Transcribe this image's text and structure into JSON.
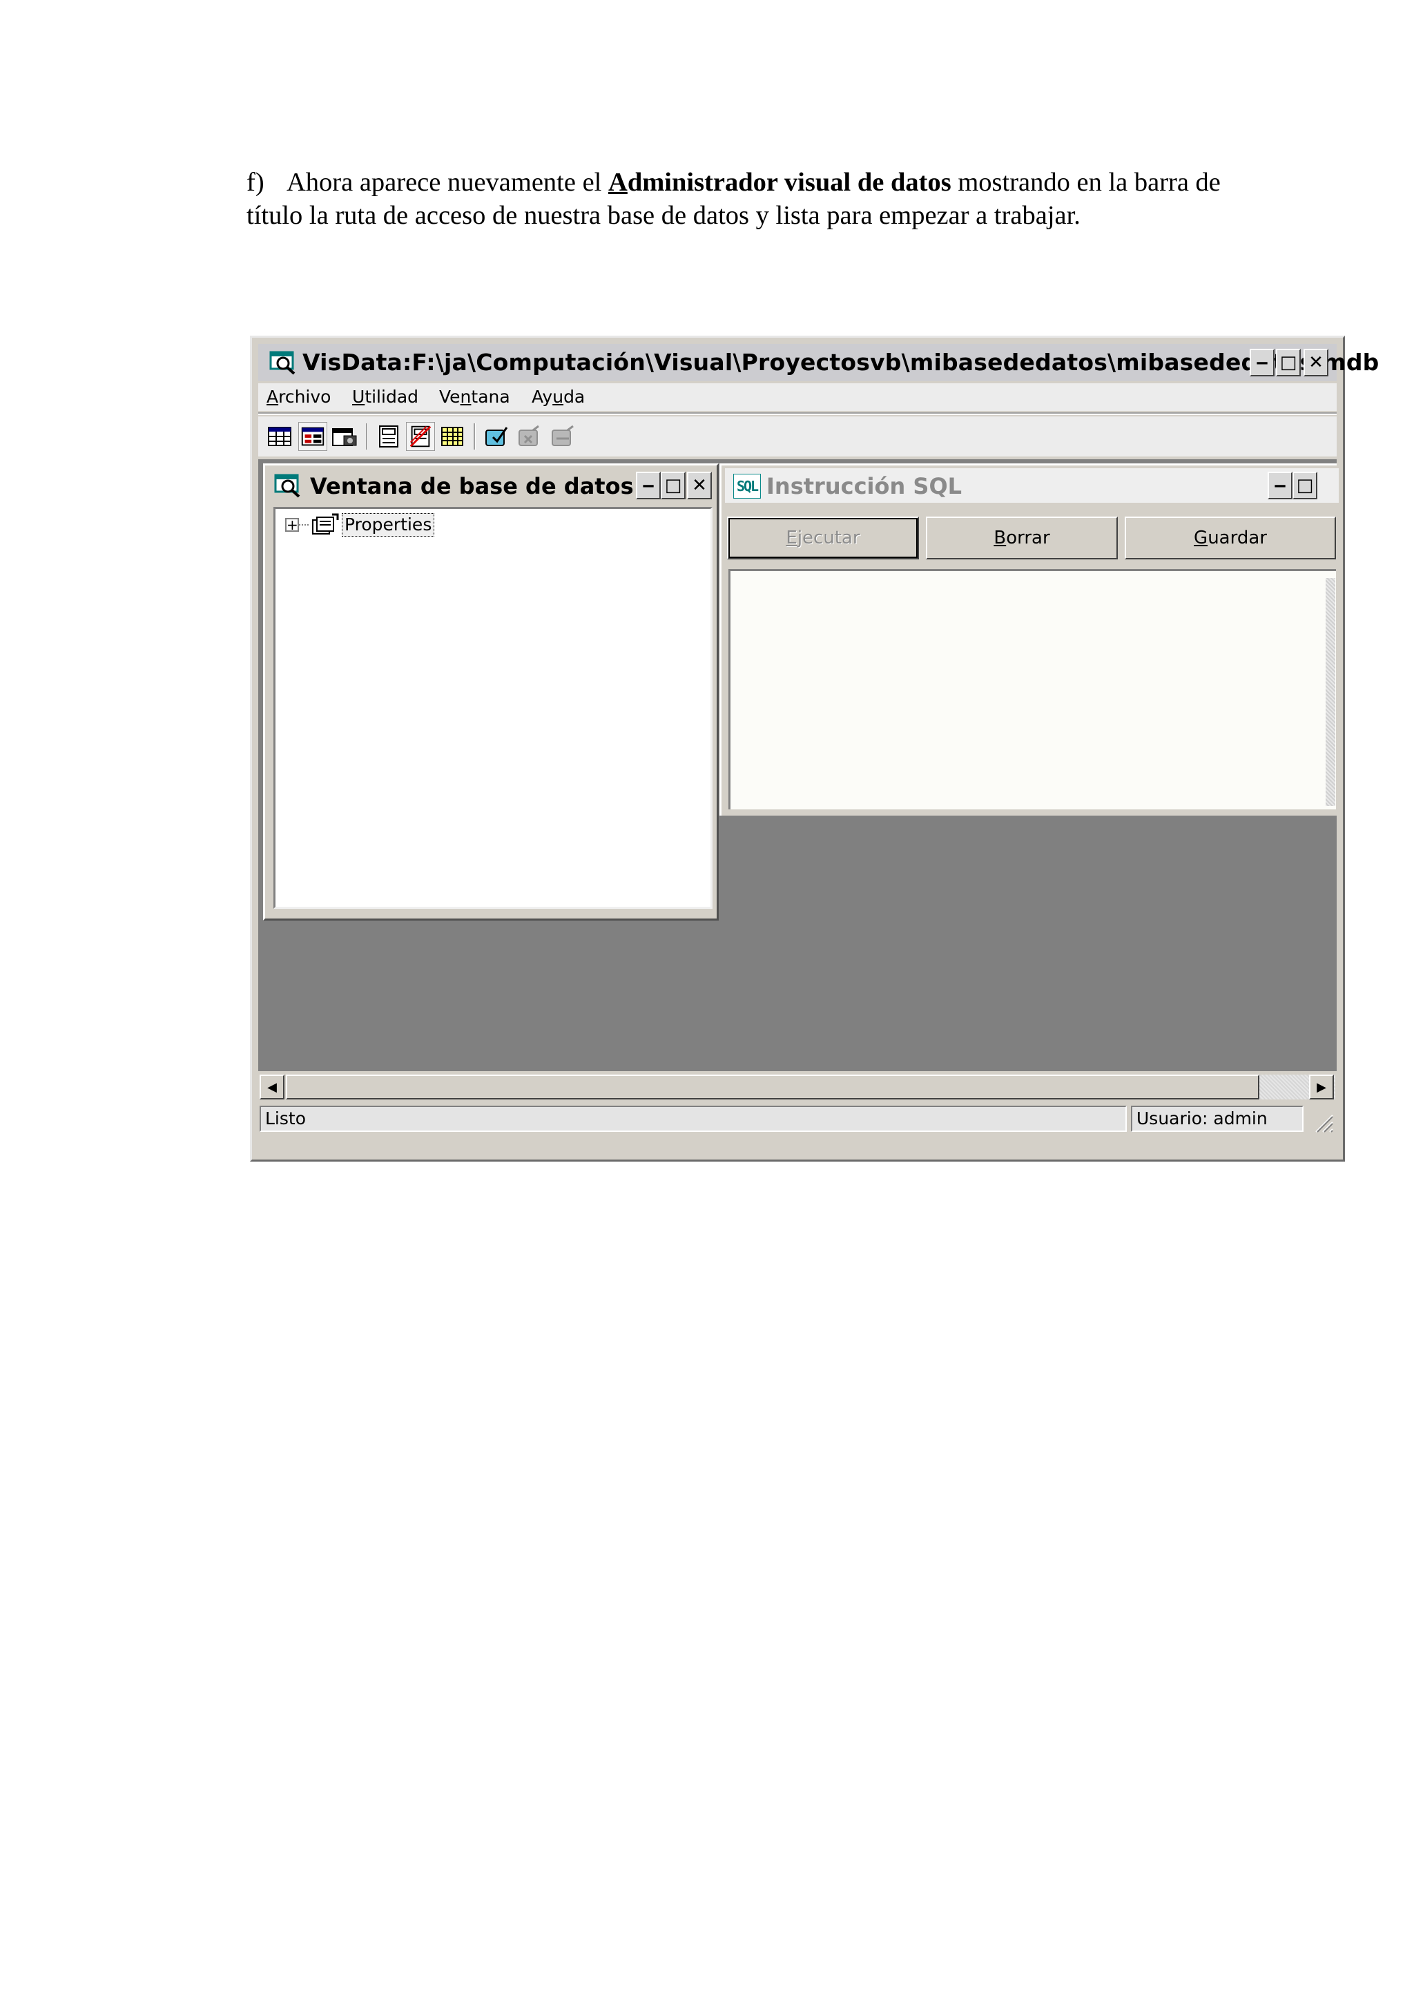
{
  "doc": {
    "label": "f)",
    "before_bold": "Ahora aparece nuevamente el ",
    "bold_first": "A",
    "bold_rest": "dministrador visual de datos",
    "after_bold": " mostrando en la barra de título la ruta de acceso de nuestra base de datos y lista para empezar a trabajar."
  },
  "app": {
    "title": "VisData:F:\\ja\\Computación\\Visual\\Proyectosvb\\mibasededatos\\mibasededatos.mdb",
    "menu": [
      {
        "mn": "A",
        "rest": "rchivo"
      },
      {
        "mn": "U",
        "rest": "tilidad"
      },
      {
        "pre": "Ve",
        "mn": "n",
        "rest": "tana"
      },
      {
        "pre": "Ay",
        "mn": "u",
        "rest": "da"
      }
    ],
    "icons": {
      "table": "table-view-icon",
      "form": "form-view-icon",
      "grid": "grid-view-icon"
    }
  },
  "db_window": {
    "title": "Ventana de base de datos",
    "tree": [
      {
        "label": "Properties"
      }
    ]
  },
  "sql_window": {
    "title": "Instrucción SQL",
    "badge": "SQL",
    "buttons": {
      "execute": {
        "mn": "E",
        "rest": "jecutar"
      },
      "clear": {
        "mn": "B",
        "rest": "orrar"
      },
      "save": {
        "mn": "G",
        "rest": "uardar"
      }
    },
    "text": ""
  },
  "status": {
    "left": "Listo",
    "user": "Usuario: admin"
  },
  "colors": {
    "mdi_background": "#808080",
    "face": "#d4d0c8",
    "accent_teal": "#007a7a"
  }
}
